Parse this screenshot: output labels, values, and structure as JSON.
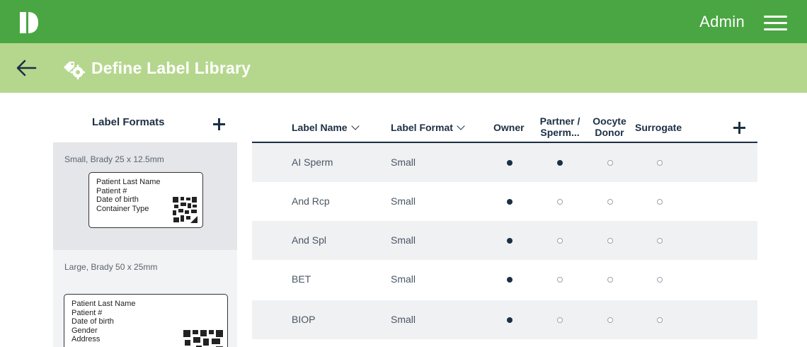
{
  "header": {
    "user_label": "Admin",
    "logo_icon": "app-logo-icon",
    "menu_icon": "hamburger-menu-icon",
    "bar_color": "#4aa642"
  },
  "subheader": {
    "title": "Define Label Library",
    "back_icon": "back-arrow-icon",
    "title_icon": "label-settings-icon",
    "bar_color": "#b5d78d"
  },
  "formats_panel": {
    "title": "Label Formats",
    "items": [
      {
        "name": "Small, Brady 25 x 12.5mm",
        "selected": true,
        "lines": [
          "Patient Last Name",
          "Patient #",
          "Date of birth",
          "Container Type"
        ]
      },
      {
        "name": "Large, Brady 50 x 25mm",
        "selected": false,
        "lines": [
          "Patient Last Name",
          "Patient #",
          "Date of birth",
          "Gender",
          "Address"
        ]
      }
    ]
  },
  "table": {
    "columns": {
      "label_name": "Label Name",
      "label_format": "Label Format",
      "owner": "Owner",
      "partner": [
        "Partner /",
        "Sperm..."
      ],
      "donor": [
        "Oocyte",
        "Donor"
      ],
      "surrogate": "Surrogate"
    },
    "rows": [
      {
        "name": "AI Sperm",
        "format": "Small",
        "owner": true,
        "partner": true,
        "donor": false,
        "surrogate": false
      },
      {
        "name": "And Rcp",
        "format": "Small",
        "owner": true,
        "partner": false,
        "donor": false,
        "surrogate": false
      },
      {
        "name": "And Spl",
        "format": "Small",
        "owner": true,
        "partner": false,
        "donor": false,
        "surrogate": false
      },
      {
        "name": "BET",
        "format": "Small",
        "owner": true,
        "partner": false,
        "donor": false,
        "surrogate": false
      },
      {
        "name": "BIOP",
        "format": "Small",
        "owner": true,
        "partner": false,
        "donor": false,
        "surrogate": false
      }
    ]
  }
}
